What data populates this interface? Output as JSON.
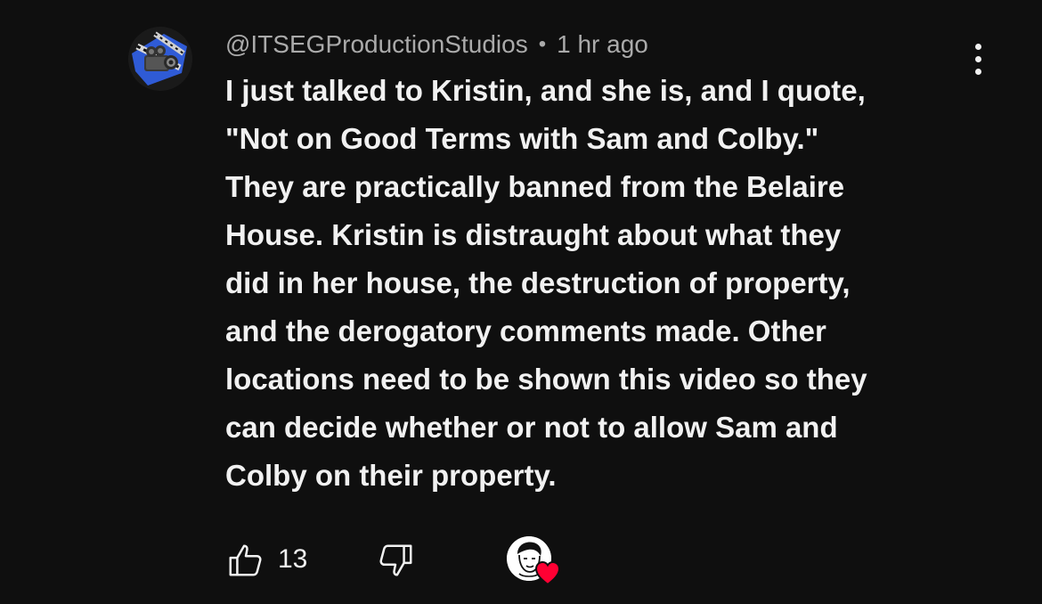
{
  "comment": {
    "author": "@ITSEGProductionStudios",
    "separator": "•",
    "timestamp": "1 hr ago",
    "body_lines": [
      "I just talked to Kristin, and she is, and I quote,",
      "\"Not on Good Terms with Sam and Colby.\"",
      "They are practically banned from the Belaire",
      "House. Kristin is distraught about what they",
      "did in her house, the destruction of property,",
      "and the derogatory comments made. Other",
      "locations need to be shown this video so they",
      "can decide whether or not to allow Sam and",
      "Colby on their property."
    ],
    "like_count": "13"
  },
  "icons": {
    "avatar": "camera-avatar-icon",
    "menu": "more-vertical-icon",
    "like": "thumbs-up-icon",
    "dislike": "thumbs-down-icon",
    "creator_heart": "creator-heart-icon"
  },
  "colors": {
    "background": "#0f0f0f",
    "text_primary": "#f1f1f1",
    "text_secondary": "#aaaaaa",
    "heart": "#ff0033",
    "avatar_accent": "#2f5bd6"
  }
}
